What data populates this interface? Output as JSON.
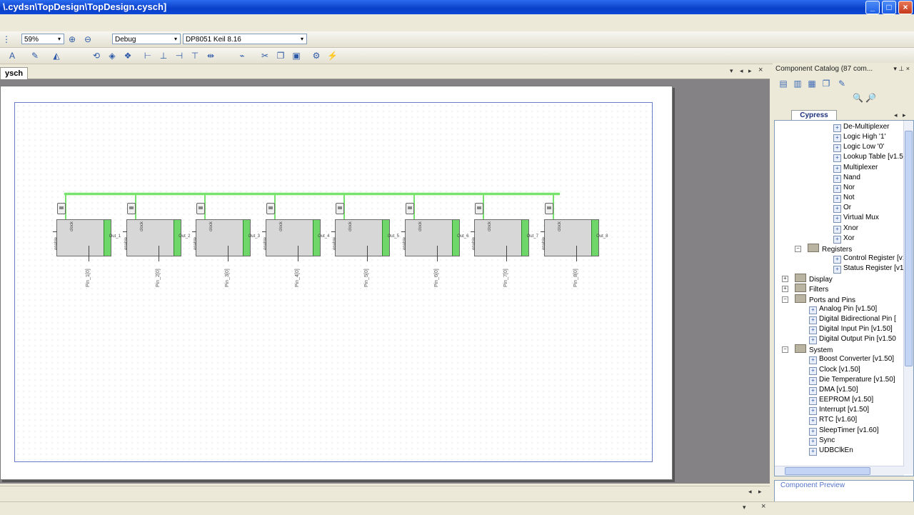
{
  "window": {
    "title": "\\.cydsn\\TopDesign\\TopDesign.cysch]",
    "minimize_glyph": "_",
    "maximize_glyph": "□",
    "close_glyph": "×"
  },
  "toolbar": {
    "zoom_value": "59%",
    "config_value": "Debug",
    "compiler_value": "DP8051 Keil 8.16",
    "dropdown_glyph": "▾"
  },
  "document": {
    "tab_label": "ysch",
    "nav_prev": "◂",
    "nav_next": "▸",
    "close_glyph": "×",
    "components": [
      {
        "in": "enable",
        "out": "Out_1",
        "clk": "clock",
        "pin": "Pin_1[0]"
      },
      {
        "in": "enable",
        "out": "Out_2",
        "clk": "clock",
        "pin": "Pin_2[0]"
      },
      {
        "in": "enable",
        "out": "Out_3",
        "clk": "clock",
        "pin": "Pin_3[0]"
      },
      {
        "in": "enable",
        "out": "Out_4",
        "clk": "clock",
        "pin": "Pin_4[0]"
      },
      {
        "in": "enable",
        "out": "Out_5",
        "clk": "clock",
        "pin": "Pin_5[0]"
      },
      {
        "in": "enable",
        "out": "Out_6",
        "clk": "clock",
        "pin": "Pin_6[0]"
      },
      {
        "in": "enable",
        "out": "Out_7",
        "clk": "clock",
        "pin": "Pin_7[0]"
      },
      {
        "in": "enable",
        "out": "Out_8",
        "clk": "clock",
        "pin": "Pin_8[0]"
      }
    ]
  },
  "catalog": {
    "header": "Component Catalog (87 com...",
    "pin_glyph": "▾ ⊥ ×",
    "tab_label": "Cypress",
    "preview_label": "Component Preview",
    "items": [
      {
        "label": "De-Multiplexer",
        "kind": "item"
      },
      {
        "label": "Logic High '1'",
        "kind": "item"
      },
      {
        "label": "Logic Low '0'",
        "kind": "item"
      },
      {
        "label": "Lookup Table [v1.5",
        "kind": "item"
      },
      {
        "label": "Multiplexer",
        "kind": "item"
      },
      {
        "label": "Nand",
        "kind": "item"
      },
      {
        "label": "Nor",
        "kind": "item"
      },
      {
        "label": "Not",
        "kind": "item"
      },
      {
        "label": "Or",
        "kind": "item"
      },
      {
        "label": "Virtual Mux",
        "kind": "item"
      },
      {
        "label": "Xnor",
        "kind": "item"
      },
      {
        "label": "Xor",
        "kind": "item"
      },
      {
        "label": "Registers",
        "kind": "subfolder"
      },
      {
        "label": "Control Register [v1.",
        "kind": "item"
      },
      {
        "label": "Status Register [v1.5",
        "kind": "item"
      },
      {
        "label": "Display",
        "kind": "folder"
      },
      {
        "label": "Filters",
        "kind": "folder"
      },
      {
        "label": "Ports and Pins",
        "kind": "folder-open"
      },
      {
        "label": "Analog Pin [v1.50]",
        "kind": "item2"
      },
      {
        "label": "Digital Bidirectional Pin [",
        "kind": "item2"
      },
      {
        "label": "Digital Input Pin [v1.50]",
        "kind": "item2"
      },
      {
        "label": "Digital Output Pin [v1.50",
        "kind": "item2"
      },
      {
        "label": "System",
        "kind": "folder-open"
      },
      {
        "label": "Boost Converter [v1.50]",
        "kind": "item2"
      },
      {
        "label": "Clock [v1.50]",
        "kind": "item2"
      },
      {
        "label": "Die Temperature [v1.50]",
        "kind": "item2"
      },
      {
        "label": "DMA [v1.50]",
        "kind": "item2"
      },
      {
        "label": "EEPROM [v1.50]",
        "kind": "item2"
      },
      {
        "label": "Interrupt [v1.50]",
        "kind": "item2"
      },
      {
        "label": "RTC [v1.60]",
        "kind": "item2"
      },
      {
        "label": "SleepTimer [v1.60]",
        "kind": "item2"
      },
      {
        "label": "Sync",
        "kind": "item2"
      },
      {
        "label": "UDBClkEn",
        "kind": "item2"
      }
    ]
  }
}
